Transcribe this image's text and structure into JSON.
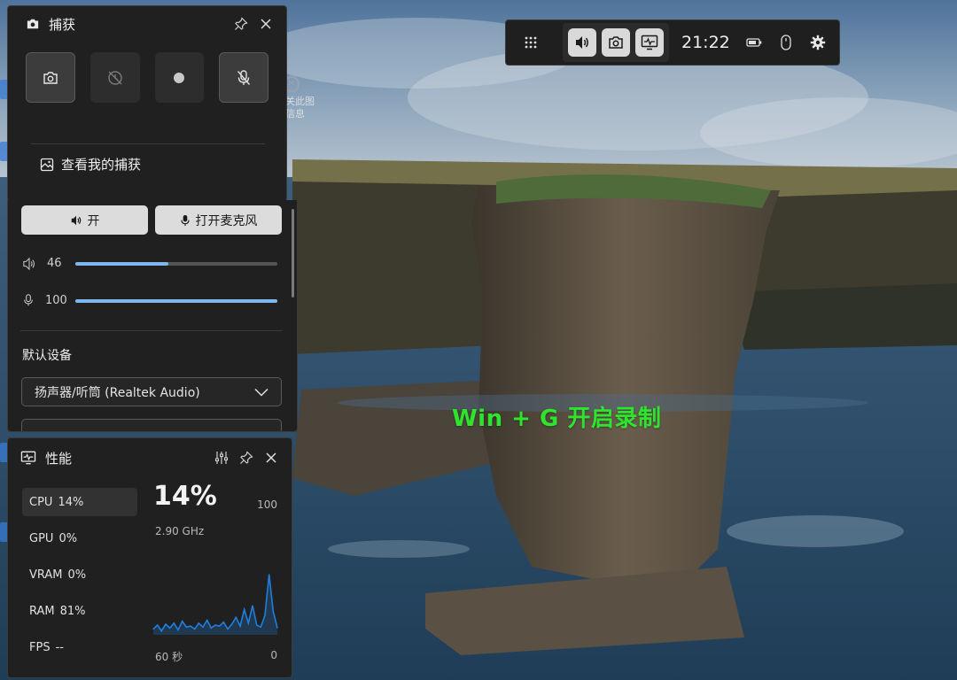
{
  "wallpaper": {
    "description_colors": {
      "sky": "#5a7fa6",
      "cliff": "#4a4438",
      "sea": "#2f4f6b"
    }
  },
  "desktop": {
    "stray_shortcut": {
      "line1": "关此图",
      "line2": "信息"
    }
  },
  "overlay_hint": "Win + G 开启录制",
  "gamebar": {
    "time": "21:22",
    "icons": [
      "widget-menu-icon",
      "audio-icon",
      "capture-icon",
      "performance-icon",
      "battery-icon",
      "mouse-icon",
      "settings-icon"
    ]
  },
  "capture": {
    "title": "捕获",
    "buttons": [
      "screenshot-icon",
      "record-last-icon",
      "record-icon",
      "mic-off-icon"
    ],
    "view_captures": "查看我的捕获"
  },
  "audio": {
    "speaker_toggle": "开",
    "mic_toggle": "打开麦克风",
    "speaker_volume": 46,
    "mic_volume": 100,
    "default_device_label": "默认设备",
    "device": "扬声器/听筒 (Realtek Audio)"
  },
  "performance": {
    "title": "性能",
    "items": [
      {
        "name": "CPU",
        "value": "14%"
      },
      {
        "name": "GPU",
        "value": "0%"
      },
      {
        "name": "VRAM",
        "value": "0%"
      },
      {
        "name": "RAM",
        "value": "81%"
      },
      {
        "name": "FPS",
        "value": "--"
      }
    ],
    "big_value": "14%",
    "frequency": "2.90 GHz",
    "max_label": "100",
    "axis_left": "60 秒",
    "axis_right": "0",
    "accent": "#1e7fe0"
  },
  "chart_data": {
    "type": "area",
    "title": "",
    "xlabel": "60 秒",
    "ylabel": "",
    "ylim": [
      0,
      100
    ],
    "xlim": [
      60,
      0
    ],
    "x": [
      60,
      58,
      56,
      54,
      52,
      50,
      48,
      46,
      44,
      42,
      40,
      38,
      36,
      34,
      32,
      30,
      28,
      26,
      24,
      22,
      20,
      18,
      16,
      14,
      12,
      10,
      8,
      6,
      4,
      2,
      0
    ],
    "values": [
      6,
      10,
      4,
      11,
      7,
      12,
      5,
      14,
      8,
      9,
      6,
      12,
      8,
      15,
      7,
      10,
      9,
      13,
      6,
      11,
      18,
      9,
      26,
      12,
      30,
      10,
      8,
      20,
      62,
      24,
      7
    ]
  }
}
